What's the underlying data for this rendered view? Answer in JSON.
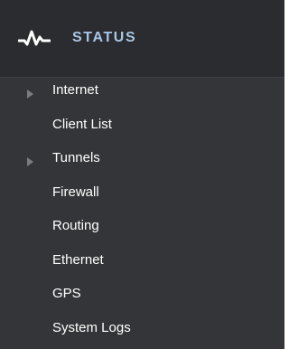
{
  "sidebar": {
    "header": {
      "icon": "pulse-icon",
      "title": "STATUS",
      "title_color": "#a8c6e6"
    },
    "items": [
      {
        "label": "Internet",
        "expandable": true
      },
      {
        "label": "Client List",
        "expandable": false
      },
      {
        "label": "Tunnels",
        "expandable": true
      },
      {
        "label": "Firewall",
        "expandable": false
      },
      {
        "label": "Routing",
        "expandable": false
      },
      {
        "label": "Ethernet",
        "expandable": false
      },
      {
        "label": "GPS",
        "expandable": false
      },
      {
        "label": "System Logs",
        "expandable": false
      }
    ]
  }
}
